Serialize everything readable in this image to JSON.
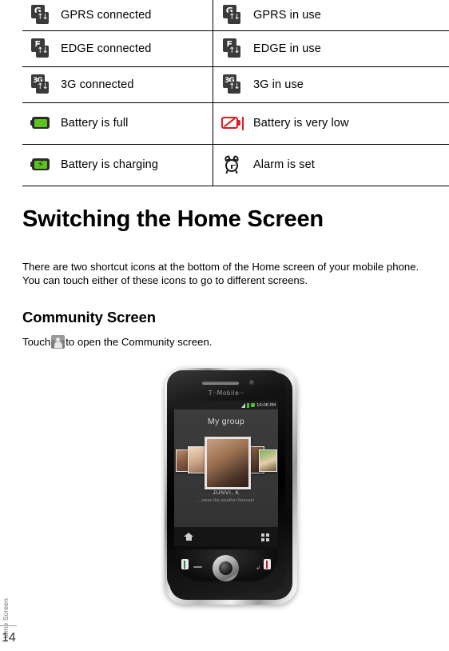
{
  "status_icon_table": {
    "rows": [
      {
        "left": {
          "icon": "gprs-connected-icon",
          "icon_type": "network",
          "glyph": "G",
          "label": "GPRS connected"
        },
        "right": {
          "icon": "gprs-in-use-icon",
          "icon_type": "network",
          "glyph": "G",
          "label": "GPRS in use"
        }
      },
      {
        "left": {
          "icon": "edge-connected-icon",
          "icon_type": "network",
          "glyph": "E",
          "label": "EDGE connected"
        },
        "right": {
          "icon": "edge-in-use-icon",
          "icon_type": "network",
          "glyph": "E",
          "label": "EDGE in use"
        }
      },
      {
        "left": {
          "icon": "3g-connected-icon",
          "icon_type": "network",
          "glyph": "3G",
          "label": "3G connected"
        },
        "right": {
          "icon": "3g-in-use-icon",
          "icon_type": "network",
          "glyph": "3G",
          "label": "3G in use"
        }
      },
      {
        "left": {
          "icon": "battery-full-icon",
          "icon_type": "battery",
          "label": "Battery is full"
        },
        "right": {
          "icon": "battery-very-low-icon",
          "icon_type": "battery-low",
          "label": "Battery is very low"
        }
      },
      {
        "left": {
          "icon": "battery-charging-icon",
          "icon_type": "battery-charging",
          "label": "Battery is charging"
        },
        "right": {
          "icon": "alarm-set-icon",
          "icon_type": "alarm",
          "label": "Alarm is set"
        }
      }
    ]
  },
  "content": {
    "heading": "Switching the Home Screen",
    "paragraph": "There are two shortcut icons at the bottom of the Home screen of your mobile phone. You can touch either of these icons to go to different screens.",
    "subheading": "Community Screen",
    "touch_prefix": "Touch",
    "touch_icon": "community-people-icon",
    "touch_suffix": "to open the Community screen."
  },
  "phone_figure": {
    "name": "phone-illustration",
    "brand": "T··Mobile··",
    "status_bar": {
      "clock": "10:08 PM"
    },
    "screen_title": "My group",
    "contact_name": "JUNVI, K",
    "contact_status": "...owes the weather forecast",
    "dock": {
      "home": "home-icon",
      "apps": "apps-grid-icon"
    },
    "hardware": {
      "send_key": "call-send-key",
      "end_key": "call-end-key",
      "trackball": "trackball"
    }
  },
  "footer": {
    "chapter_label": "Home Screen",
    "page_number": "14"
  }
}
